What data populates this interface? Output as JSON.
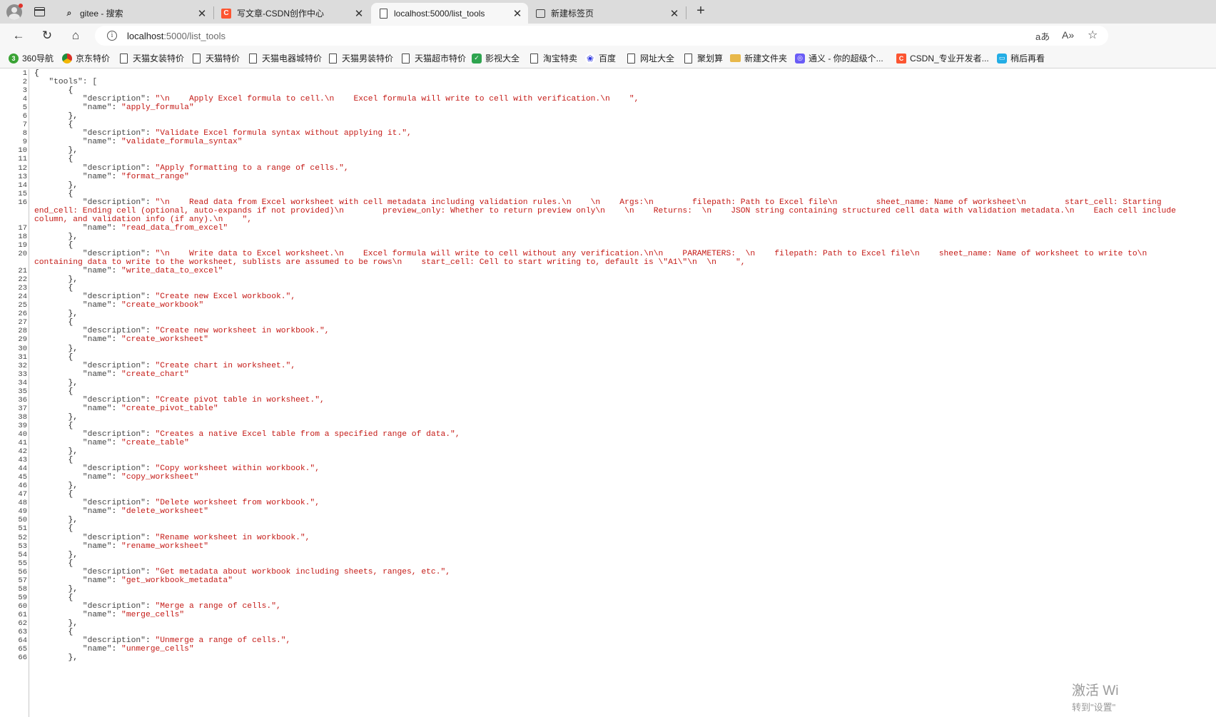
{
  "browser": {
    "tabs": [
      {
        "title": "gitee - 搜索",
        "icon": "search-icon",
        "active": false
      },
      {
        "title": "写文章-CSDN创作中心",
        "icon": "csdn-icon",
        "active": false
      },
      {
        "title": "localhost:5000/list_tools",
        "icon": "page-icon",
        "active": true
      },
      {
        "title": "新建标签页",
        "icon": "newtab-icon",
        "active": false
      }
    ],
    "address": {
      "host": "localhost",
      "path": ":5000/list_tools"
    },
    "bookmarks": [
      {
        "label": "360导航",
        "icon": "360-icon",
        "color": "#3aa335"
      },
      {
        "label": "京东特价",
        "icon": "chrome-icon",
        "color": "#d93025"
      },
      {
        "label": "天猫女装特价",
        "icon": "page-icon"
      },
      {
        "label": "天猫特价",
        "icon": "page-icon"
      },
      {
        "label": "天猫电器城特价",
        "icon": "page-icon"
      },
      {
        "label": "天猫男装特价",
        "icon": "page-icon"
      },
      {
        "label": "天猫超市特价",
        "icon": "page-icon"
      },
      {
        "label": "影视大全",
        "icon": "video-icon",
        "color": "#2ea44f"
      },
      {
        "label": "淘宝特卖",
        "icon": "page-icon"
      },
      {
        "label": "百度",
        "icon": "baidu-icon",
        "color": "#2932e1"
      },
      {
        "label": "网址大全",
        "icon": "page-icon"
      },
      {
        "label": "聚划算",
        "icon": "page-icon"
      },
      {
        "label": "新建文件夹",
        "icon": "folder-icon"
      },
      {
        "label": "通义 - 你的超级个...",
        "icon": "tongyi-icon",
        "color": "#6a5cf6"
      },
      {
        "label": "CSDN_专业开发者...",
        "icon": "csdn-icon",
        "color": "#fc5531"
      },
      {
        "label": "稍后再看",
        "icon": "bilibili-icon",
        "color": "#23ade5"
      }
    ]
  },
  "json_view": {
    "tools_key": "\"tools\": [",
    "items": [
      {
        "description": "\"\\n    Apply Excel formula to cell.\\n    Excel formula will write to cell with verification.\\n    \",",
        "name": "\"apply_formula\""
      },
      {
        "description": "\"Validate Excel formula syntax without applying it.\",",
        "name": "\"validate_formula_syntax\""
      },
      {
        "description": "\"Apply formatting to a range of cells.\",",
        "name": "\"format_range\""
      },
      {
        "description": "\"\\n    Read data from Excel worksheet with cell metadata including validation rules.\\n    \\n    Args:\\n        filepath: Path to Excel file\\n        sheet_name: Name of worksheet\\n        start_cell: Starting",
        "cont": [
          "end_cell: Ending cell (optional, auto-expands if not provided)\\n        preview_only: Whether to return preview only\\n    \\n    Returns:  \\n    JSON string containing structured cell data with validation metadata.\\n    Each cell include",
          "column, and validation info (if any).\\n    \","
        ],
        "name": "\"read_data_from_excel\""
      },
      {
        "description": "\"\\n    Write data to Excel worksheet.\\n    Excel formula will write to cell without any verification.\\n\\n    PARAMETERS:  \\n    filepath: Path to Excel file\\n    sheet_name: Name of worksheet to write to\\n",
        "cont": [
          "containing data to write to the worksheet, sublists are assumed to be rows\\n    start_cell: Cell to start writing to, default is \\\"A1\\\"\\n  \\n    \","
        ],
        "name": "\"write_data_to_excel\""
      },
      {
        "description": "\"Create new Excel workbook.\",",
        "name": "\"create_workbook\""
      },
      {
        "description": "\"Create new worksheet in workbook.\",",
        "name": "\"create_worksheet\""
      },
      {
        "description": "\"Create chart in worksheet.\",",
        "name": "\"create_chart\""
      },
      {
        "description": "\"Create pivot table in worksheet.\",",
        "name": "\"create_pivot_table\""
      },
      {
        "description": "\"Creates a native Excel table from a specified range of data.\",",
        "name": "\"create_table\""
      },
      {
        "description": "\"Copy worksheet within workbook.\",",
        "name": "\"copy_worksheet\""
      },
      {
        "description": "\"Delete worksheet from workbook.\",",
        "name": "\"delete_worksheet\""
      },
      {
        "description": "\"Rename worksheet in workbook.\",",
        "name": "\"rename_worksheet\""
      },
      {
        "description": "\"Get metadata about workbook including sheets, ranges, etc.\",",
        "name": "\"get_workbook_metadata\""
      },
      {
        "description": "\"Merge a range of cells.\",",
        "name": "\"merge_cells\""
      },
      {
        "description": "\"Unmerge a range of cells.\",",
        "name": "\"unmerge_cells\""
      }
    ]
  },
  "watermark": {
    "line1": "激活 Wi",
    "line2": "转到\"设置\""
  }
}
